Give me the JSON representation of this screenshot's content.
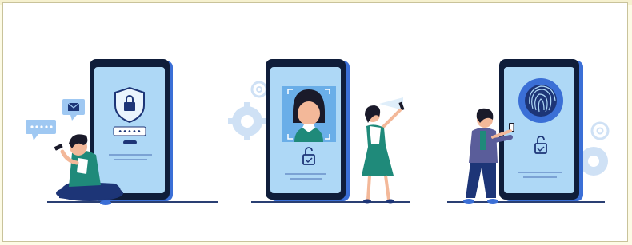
{
  "illustration": {
    "panels": [
      {
        "name": "pin-password-login",
        "masked_pin": "•••••"
      },
      {
        "name": "face-recognition-login"
      },
      {
        "name": "fingerprint-login"
      }
    ],
    "colors": {
      "phone_body": "#0f1d3a",
      "phone_screen": "#aed8f6",
      "accent_blue": "#3b6fd6",
      "gear_light": "#cfe1f5",
      "shirt_teal": "#1f8a7a",
      "pants_navy": "#1d3577",
      "skin": "#f3b899",
      "hair": "#1a1a2a",
      "shelf_line": "#2a3f73"
    }
  }
}
